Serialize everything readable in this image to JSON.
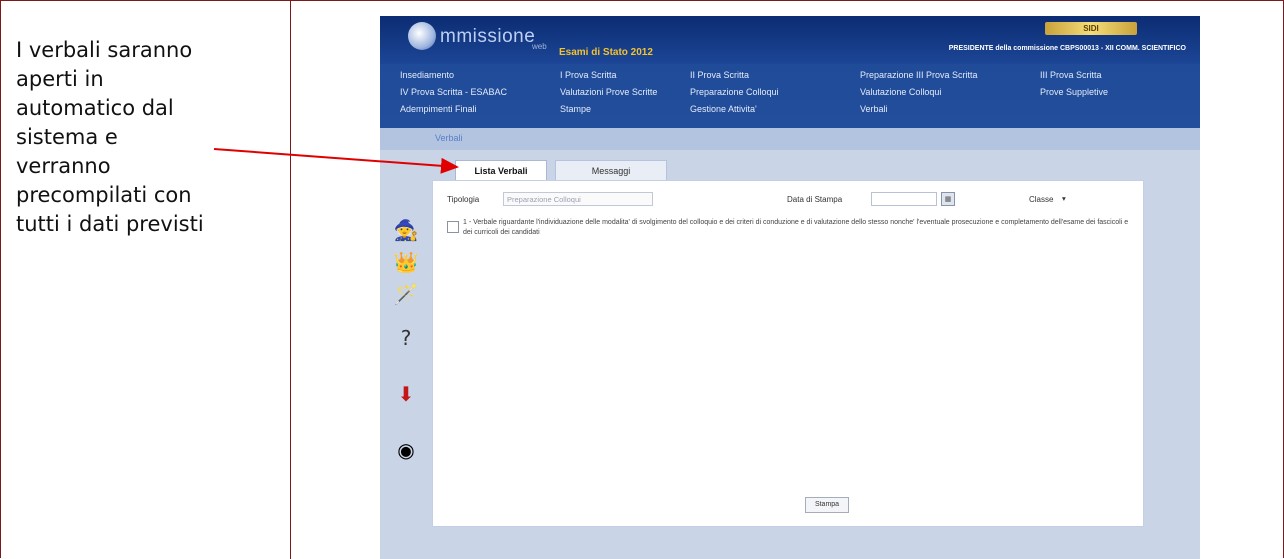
{
  "note": {
    "lines": [
      "I verbali saranno",
      "aperti in",
      "automatico dal",
      "sistema e",
      "verranno",
      "precompilati con",
      "tutti i dati previsti"
    ]
  },
  "header": {
    "logo_text": "mmissione",
    "logo_sub": "web",
    "esami": "Esami di Stato 2012",
    "presidente": "PRESIDENTE della commissione CBPS00013 - XII COMM. SCIENTIFICO",
    "brand_color": "#f2c230"
  },
  "menu": {
    "items": [
      "Insediamento",
      "I Prova Scritta",
      "II Prova Scritta",
      "Preparazione III Prova Scritta",
      "III Prova Scritta",
      "IV Prova Scritta - ESABAC",
      "Valutazioni Prove Scritte",
      "Preparazione Colloqui",
      "Valutazione Colloqui",
      "Prove Suppletive",
      "Adempimenti Finali",
      "Stampe",
      "Gestione Attivita'",
      "Verbali"
    ]
  },
  "breadcrumb": "Verbali",
  "tabs": [
    "Lista Verbali",
    "Messaggi"
  ],
  "form": {
    "tipologia_label": "Tipologia",
    "tipologia_value": "Preparazione Colloqui",
    "data_label": "Data di Stampa",
    "data_value": "",
    "classe_label": "Classe"
  },
  "verbale_text": "1 - Verbale riguardante l'individuazione delle modalita' di svolgimento del colloquio e dei criteri di conduzione e di valutazione dello stesso nonche' l'eventuale prosecuzione e completamento dell'esame dei fascicoli e dei curricoli dei candidati",
  "stampa_button": "Stampa",
  "colors": {
    "frame": "#7a1a1a",
    "header": "#1c4696",
    "arrow": "#e00000"
  }
}
